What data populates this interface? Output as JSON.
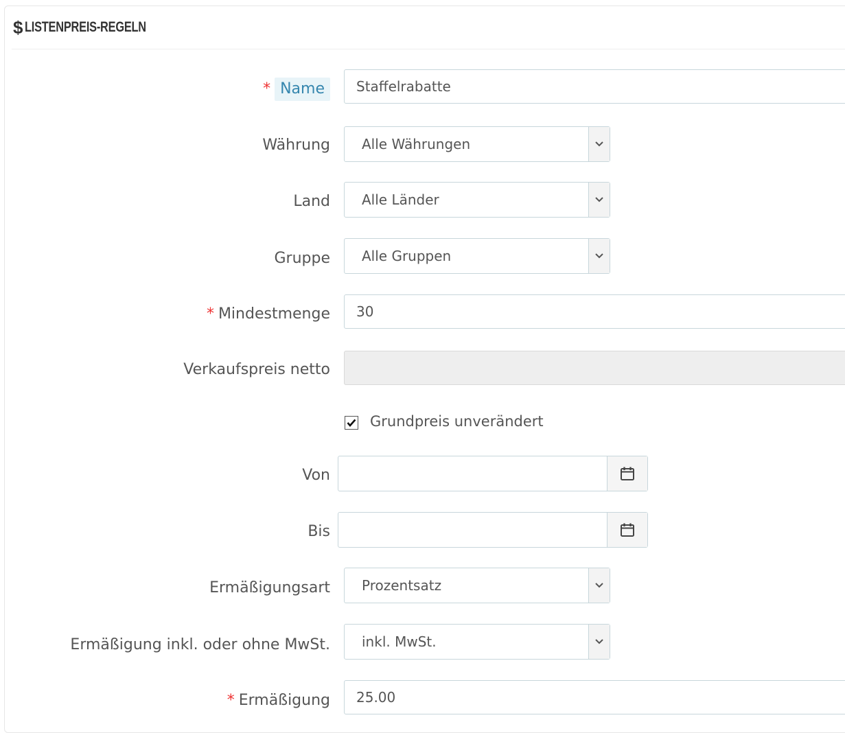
{
  "panel": {
    "heading_icon": "$",
    "heading_title": "LISTENPREIS-REGELN"
  },
  "form": {
    "required_mark": "*",
    "name": {
      "label": "Name",
      "value": "Staffelrabatte"
    },
    "currency": {
      "label": "Währung",
      "value": "Alle Währungen"
    },
    "country": {
      "label": "Land",
      "value": "Alle Länder"
    },
    "group": {
      "label": "Gruppe",
      "value": "Alle Gruppen"
    },
    "min_quantity": {
      "label": "Mindestmenge",
      "value": "30"
    },
    "net_price": {
      "label": "Verkaufspreis netto",
      "value": ""
    },
    "keep_base_price": {
      "label": "Grundpreis unverändert",
      "checked": true
    },
    "from": {
      "label": "Von",
      "value": ""
    },
    "to": {
      "label": "Bis",
      "value": ""
    },
    "reduction_type": {
      "label": "Ermäßigungsart",
      "value": "Prozentsatz"
    },
    "reduction_tax": {
      "label": "Ermäßigung inkl. oder ohne MwSt.",
      "value": "inkl. MwSt."
    },
    "reduction": {
      "label": "Ermäßigung",
      "value": "25.00"
    }
  },
  "icons": {
    "heading": "dollar-icon",
    "select_arrow": "chevron-down-icon",
    "date": "calendar-icon",
    "checkbox": "checkmark-icon"
  }
}
